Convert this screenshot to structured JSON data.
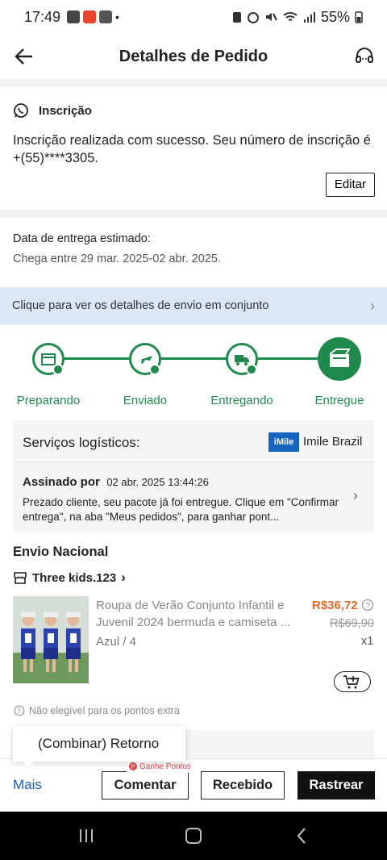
{
  "status_bar": {
    "time": "17:49",
    "battery": "55%"
  },
  "header": {
    "title": "Detalhes de Pedido"
  },
  "subscription": {
    "title": "Inscrição",
    "text": "Inscrição realizada com sucesso. Seu número de inscrição é +(55)****3305.",
    "edit_label": "Editar"
  },
  "delivery": {
    "label": "Data de entrega estimado:",
    "range": "Chega entre 29 mar. 2025-02 abr. 2025."
  },
  "shipping_banner": {
    "text": "Clique para ver os detalhes de envio em conjunto"
  },
  "progress": {
    "steps": [
      {
        "label": "Preparando",
        "icon": "box-icon"
      },
      {
        "label": "Enviado",
        "icon": "plane-icon"
      },
      {
        "label": "Entregando",
        "icon": "truck-icon"
      },
      {
        "label": "Entregue",
        "icon": "delivered-box-icon"
      }
    ]
  },
  "logistics": {
    "title": "Serviços logísticos:",
    "logo_text": "iMile",
    "carrier": "Imile Brazil",
    "signed_label": "Assinado por",
    "signed_date": "02 abr. 2025 13:44:26",
    "description": "Prezado cliente, seu pacote já foi entregue. Clique em \"Confirmar entrega\", na aba \"Meus pedidos\", para ganhar pont..."
  },
  "shipment": {
    "section_title": "Envio Nacional",
    "store_name": "Three kids.123",
    "product": {
      "name": "Roupa de Verão Conjunto Infantil e Juvenil 2024 bermuda e camiseta ...",
      "variant": "Azul / 4",
      "price": "R$36,72",
      "old_price": "R$69,90",
      "quantity": "x1"
    },
    "not_eligible": "Não elegível para os pontos extra"
  },
  "popup": {
    "label": "(Combinar) Retorno"
  },
  "bottom_bar": {
    "more_label": "Mais",
    "points_badge": "Ganhe Pontos",
    "comment_label": "Comentar",
    "received_label": "Recebido",
    "track_label": "Rastrear"
  },
  "colors": {
    "accent_green": "#1f8a4c",
    "price_orange": "#e06a2c",
    "link_blue": "#1d5fb5",
    "banner_blue": "#dbe7f7"
  }
}
